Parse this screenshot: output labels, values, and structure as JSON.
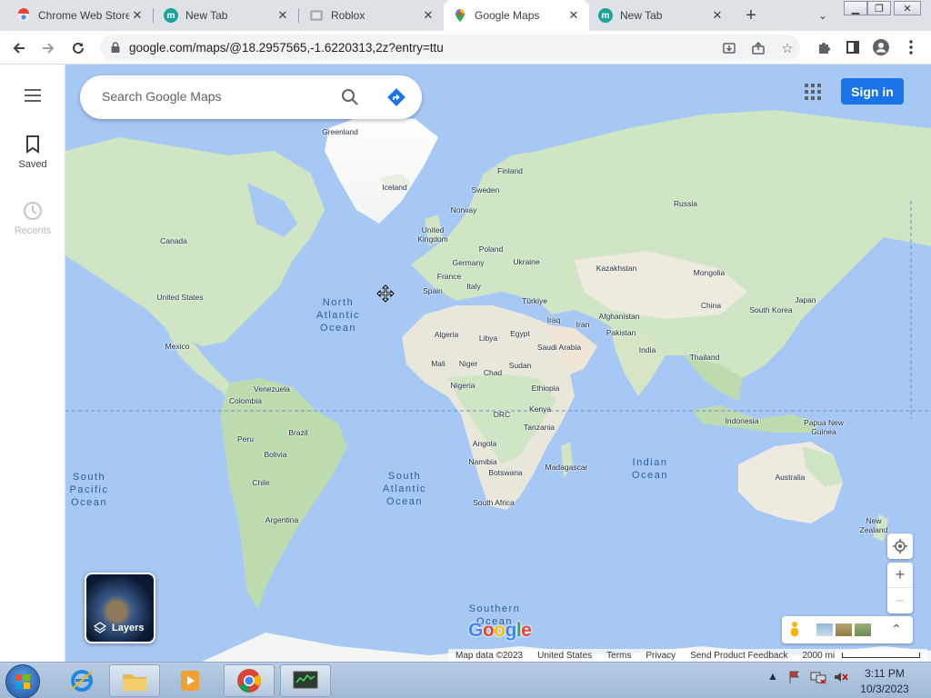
{
  "browser": {
    "tabs": [
      {
        "label": "Chrome Web Store",
        "icon": "chrome-web-store-icon",
        "active": false
      },
      {
        "label": "New Tab",
        "icon": "m-app-icon",
        "active": false
      },
      {
        "label": "Roblox",
        "icon": "roblox-icon",
        "active": false
      },
      {
        "label": "Google Maps",
        "icon": "google-maps-icon",
        "active": true
      },
      {
        "label": "New Tab",
        "icon": "m-app-icon",
        "active": false
      }
    ],
    "new_tab_symbol": "+",
    "url": "google.com/maps/@18.2957565,-1.6220313,2z?entry=ttu"
  },
  "maps": {
    "search_placeholder": "Search Google Maps",
    "signin_label": "Sign in",
    "rail": {
      "saved_label": "Saved",
      "recents_label": "Recents"
    },
    "layers_label": "Layers",
    "logo_text": "Google",
    "attribution": {
      "map_data": "Map data ©2023",
      "region": "United States",
      "terms": "Terms",
      "privacy": "Privacy",
      "feedback": "Send Product Feedback",
      "scale": "2000 mi"
    },
    "zoom_in": "+",
    "zoom_out": "−",
    "labels": {
      "greenland": "Greenland",
      "iceland": "Iceland",
      "finland": "Finland",
      "sweden": "Sweden",
      "norway": "Norway",
      "uk": "United\nKingdom",
      "russia": "Russia",
      "canada": "Canada",
      "poland": "Poland",
      "germany": "Germany",
      "ukraine": "Ukraine",
      "kazakhstan": "Kazakhstan",
      "mongolia": "Mongolia",
      "france": "France",
      "italy": "Italy",
      "spain": "Spain",
      "usa": "United States",
      "turkiye": "Türkiye",
      "china": "China",
      "japan": "Japan",
      "south_korea": "South Korea",
      "afghanistan": "Afghanistan",
      "iraq": "Iraq",
      "iran": "Iran",
      "pakistan": "Pakistan",
      "mexico": "Mexico",
      "algeria": "Algeria",
      "libya": "Libya",
      "egypt": "Egypt",
      "saudi": "Saudi Arabia",
      "india": "India",
      "thailand": "Thailand",
      "mali": "Mali",
      "niger": "Niger",
      "chad": "Chad",
      "sudan": "Sudan",
      "venezuela": "Venezuela",
      "colombia": "Colombia",
      "nigeria": "Nigeria",
      "ethiopia": "Ethiopia",
      "drc": "DRC",
      "kenya": "Kenya",
      "tanzania": "Tanzania",
      "indonesia": "Indonesia",
      "png": "Papua New\nGuinea",
      "peru": "Peru",
      "brazil": "Brazil",
      "bolivia": "Bolivia",
      "angola": "Angola",
      "namibia": "Namibia",
      "botswana": "Botswana",
      "madagascar": "Madagascar",
      "chile": "Chile",
      "south_africa": "South Africa",
      "australia": "Australia",
      "argentina": "Argentina",
      "new_zealand": "New\nZealand"
    },
    "oceans": {
      "north_atlantic": "North\nAtlantic\nOcean",
      "south_pacific": "South\nPacific\nOcean",
      "south_atlantic": "South\nAtlantic\nOcean",
      "indian": "Indian\nOcean",
      "southern": "Southern\nOcean"
    }
  },
  "taskbar": {
    "time": "3:11 PM",
    "date": "10/3/2023"
  }
}
